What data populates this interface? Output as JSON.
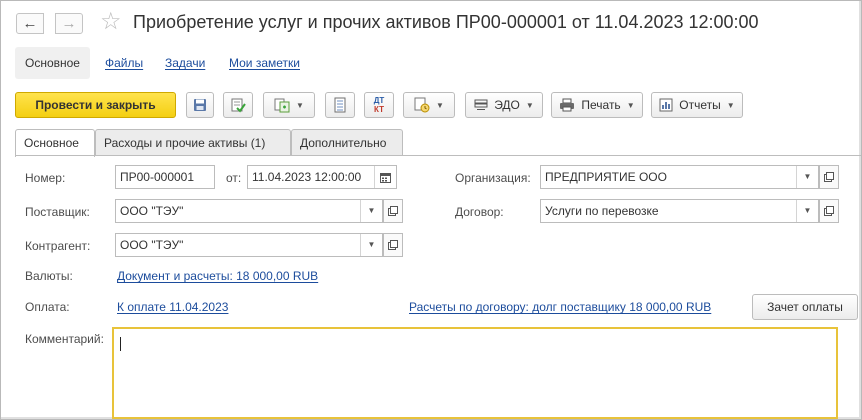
{
  "header": {
    "title": "Приобретение услуг и прочих активов ПР00-000001 от 11.04.2023 12:00:00",
    "back_icon": "←",
    "forward_icon": "→",
    "favorite_icon": "☆"
  },
  "sections": [
    {
      "label": "Основное"
    },
    {
      "label": "Файлы"
    },
    {
      "label": "Задачи"
    },
    {
      "label": "Мои заметки"
    }
  ],
  "toolbar": {
    "post_close_label": "Провести и закрыть",
    "edo_label": "ЭДО",
    "print_label": "Печать",
    "reports_label": "Отчеты",
    "dtkt_top": "ДТ",
    "dtkt_bottom": "КТ"
  },
  "tabs": [
    {
      "label": "Основное"
    },
    {
      "label": "Расходы и прочие активы (1)"
    },
    {
      "label": "Дополнительно"
    }
  ],
  "form": {
    "number_label": "Номер:",
    "number_value": "ПР00-000001",
    "date_label": "от:",
    "date_value": "11.04.2023 12:00:00",
    "organization_label": "Организация:",
    "organization_value": "ПРЕДПРИЯТИЕ ООО",
    "supplier_label": "Поставщик:",
    "supplier_value": "ООО \"ТЭУ\"",
    "contract_label": "Договор:",
    "contract_value": "Услуги по перевозке",
    "counterparty_label": "Контрагент:",
    "counterparty_value": "ООО \"ТЭУ\"",
    "currency_label": "Валюты:",
    "currency_link": "Документ и расчеты: 18 000,00 RUB",
    "payment_label": "Оплата:",
    "payment_link": "К оплате 11.04.2023",
    "settlements_link": "Расчеты по договору: долг поставщику 18 000,00 RUB",
    "offset_button": "Зачет оплаты",
    "comment_label": "Комментарий:",
    "comment_value": ""
  },
  "colors": {
    "primary_button": "#f4cf12",
    "link": "#1c4c9c",
    "focus_border": "#e8c33a"
  }
}
